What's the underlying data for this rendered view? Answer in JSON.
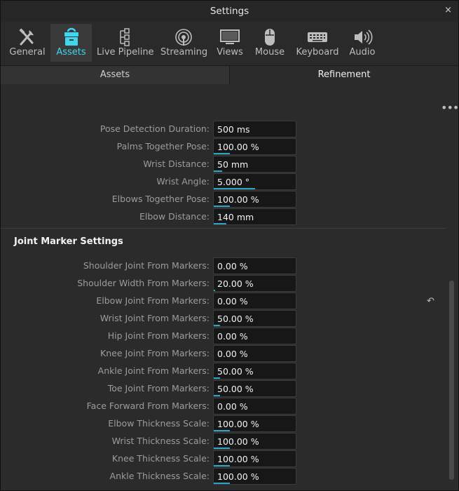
{
  "window": {
    "title": "Settings",
    "close_glyph": "×"
  },
  "toolbar": {
    "tabs": [
      {
        "label": "General",
        "icon": "tools-icon"
      },
      {
        "label": "Assets",
        "icon": "assets-icon",
        "active": true
      },
      {
        "label": "Live Pipeline",
        "icon": "pipeline-icon"
      },
      {
        "label": "Streaming",
        "icon": "streaming-icon"
      },
      {
        "label": "Views",
        "icon": "monitor-icon"
      },
      {
        "label": "Mouse",
        "icon": "mouse-icon"
      },
      {
        "label": "Keyboard",
        "icon": "keyboard-icon"
      },
      {
        "label": "Audio",
        "icon": "speaker-icon"
      }
    ],
    "accent_color": "#3fd6ef"
  },
  "subtabs": [
    "Assets",
    "Refinement"
  ],
  "refinement": {
    "more_glyph": "•••",
    "fields": [
      {
        "label": "Pose Detection Duration:",
        "value": "500 ms",
        "fill": 0.0
      },
      {
        "label": "Palms Together Pose:",
        "value": "100.00 %",
        "fill": 0.2
      },
      {
        "label": "Wrist Distance:",
        "value": "50 mm",
        "fill": 0.1
      },
      {
        "label": "Wrist Angle:",
        "value": "5.000 °",
        "fill": 0.5
      },
      {
        "label": "Elbows Together Pose:",
        "value": "100.00 %",
        "fill": 0.2
      },
      {
        "label": "Elbow Distance:",
        "value": "140 mm",
        "fill": 0.15
      }
    ]
  },
  "joint_marker_settings": {
    "title": "Joint Marker Settings",
    "reset_glyph": "↶",
    "fields": [
      {
        "label": "Shoulder Joint From Markers:",
        "value": "0.00 %",
        "fill": 0.0
      },
      {
        "label": "Shoulder Width From Markers:",
        "value": "20.00 %",
        "fill": 0.02
      },
      {
        "label": "Elbow Joint From Markers:",
        "value": "0.00 %",
        "fill": 0.0
      },
      {
        "label": "Wrist Joint From Markers:",
        "value": "50.00 %",
        "fill": 0.08
      },
      {
        "label": "Hip Joint From Markers:",
        "value": "0.00 %",
        "fill": 0.0
      },
      {
        "label": "Knee Joint From Markers:",
        "value": "0.00 %",
        "fill": 0.0
      },
      {
        "label": "Ankle Joint From Markers:",
        "value": "50.00 %",
        "fill": 0.08
      },
      {
        "label": "Toe Joint From Markers:",
        "value": "50.00 %",
        "fill": 0.08
      },
      {
        "label": "Face Forward From Markers:",
        "value": "0.00 %",
        "fill": 0.0
      },
      {
        "label": "Elbow Thickness Scale:",
        "value": "100.00 %",
        "fill": 0.2
      },
      {
        "label": "Wrist Thickness Scale:",
        "value": "100.00 %",
        "fill": 0.2
      },
      {
        "label": "Knee Thickness Scale:",
        "value": "100.00 %",
        "fill": 0.2
      },
      {
        "label": "Ankle Thickness Scale:",
        "value": "100.00 %",
        "fill": 0.2
      }
    ]
  }
}
